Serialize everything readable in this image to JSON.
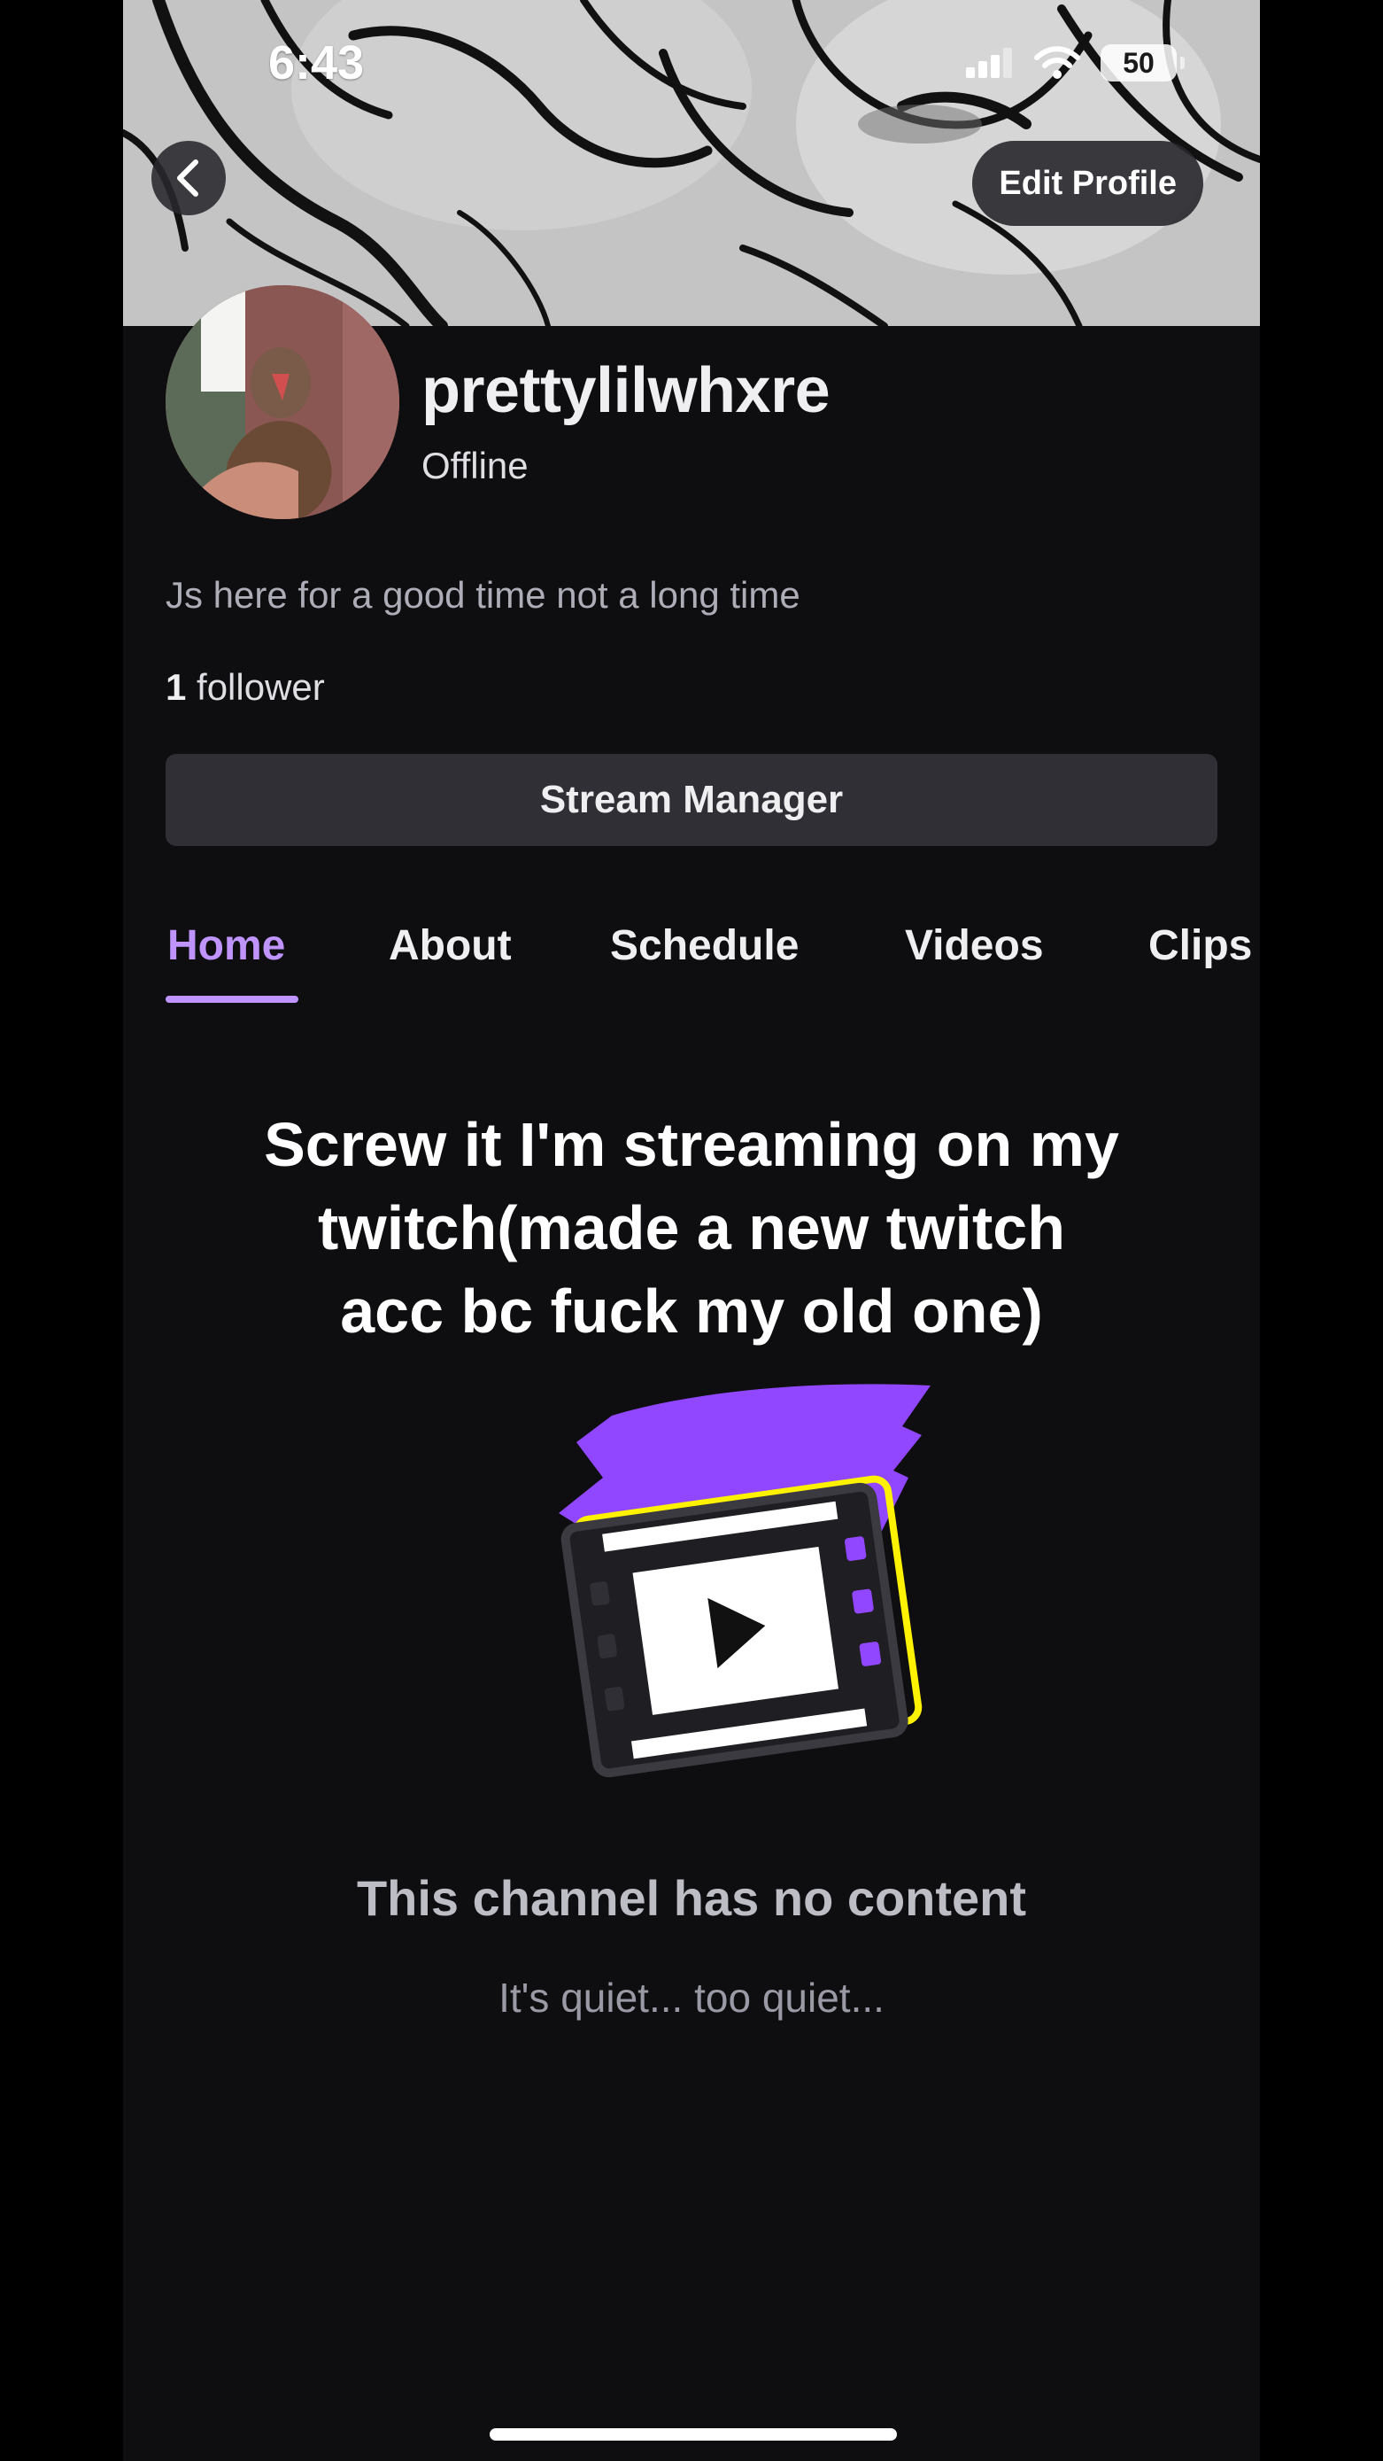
{
  "status_bar": {
    "time": "6:43",
    "battery": "50",
    "icons": [
      "signal-icon",
      "wifi-icon",
      "battery-icon"
    ]
  },
  "header": {
    "back_icon": "chevron-left-icon",
    "edit_profile_label": "Edit Profile"
  },
  "profile": {
    "username": "prettylilwhxre",
    "status": "Offline",
    "bio": "Js here for a good time not a long time",
    "follower_count": "1",
    "follower_label": " follower"
  },
  "stream_manager_label": "Stream Manager",
  "tabs": [
    {
      "label": "Home",
      "active": true
    },
    {
      "label": "About"
    },
    {
      "label": "Schedule"
    },
    {
      "label": "Videos"
    },
    {
      "label": "Clips"
    }
  ],
  "content": {
    "headline_lines": [
      "Screw it I'm streaming on my",
      "twitch(made a new twitch",
      "acc bc fuck my old one)"
    ],
    "empty_title": "This channel has no content",
    "empty_subtitle": "It's quiet... too quiet..."
  },
  "colors": {
    "accent": "#bf94ff",
    "background": "#0e0e10",
    "button": "#2f2f35",
    "illustration_purple": "#9147ff",
    "illustration_yellow": "#fff200"
  }
}
